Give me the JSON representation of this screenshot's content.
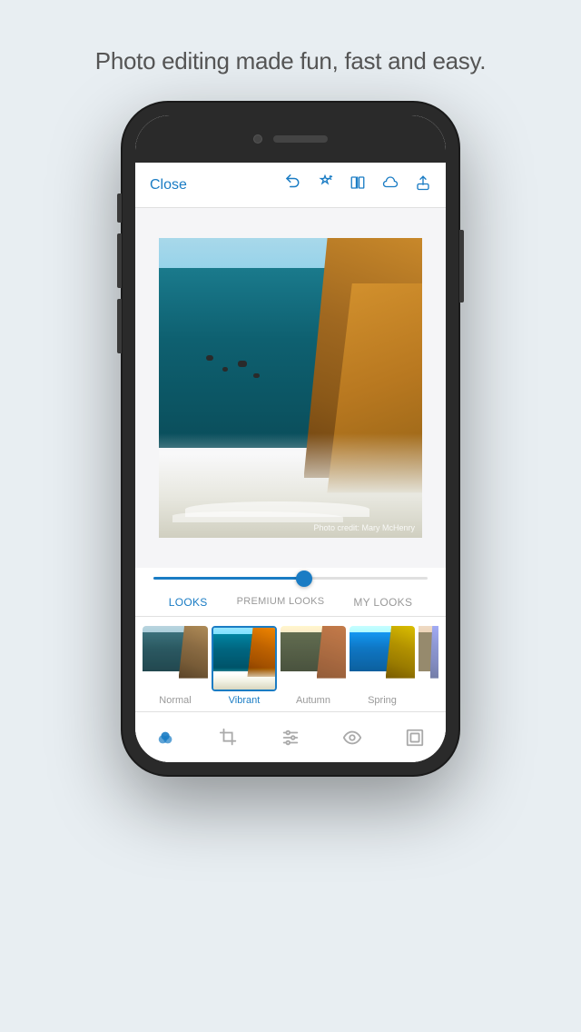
{
  "tagline": "Photo editing made fun, fast and easy.",
  "toolbar": {
    "close_label": "Close",
    "icons": [
      "undo",
      "auto-enhance",
      "compare",
      "creative-cloud",
      "share"
    ]
  },
  "photo": {
    "credit": "Photo credit: Mary McHenry"
  },
  "looks_tabs": [
    {
      "id": "looks",
      "label": "LOOKS",
      "active": true
    },
    {
      "id": "premium-looks",
      "label": "PREMIUM LOOKS",
      "active": false
    },
    {
      "id": "my-looks",
      "label": "MY LOOKS",
      "active": false
    }
  ],
  "filters": [
    {
      "id": "normal",
      "label": "Normal",
      "active": false
    },
    {
      "id": "vibrant",
      "label": "Vibrant",
      "active": true
    },
    {
      "id": "autumn",
      "label": "Autumn",
      "active": false
    },
    {
      "id": "spring",
      "label": "Spring",
      "active": false
    }
  ],
  "bottom_nav": [
    {
      "id": "looks",
      "label": "Looks",
      "active": true
    },
    {
      "id": "crop",
      "label": "Crop",
      "active": false
    },
    {
      "id": "adjustments",
      "label": "Adjust",
      "active": false
    },
    {
      "id": "details",
      "label": "Details",
      "active": false
    },
    {
      "id": "frames",
      "label": "Frames",
      "active": false
    }
  ],
  "accent_color": "#1a7cc4"
}
